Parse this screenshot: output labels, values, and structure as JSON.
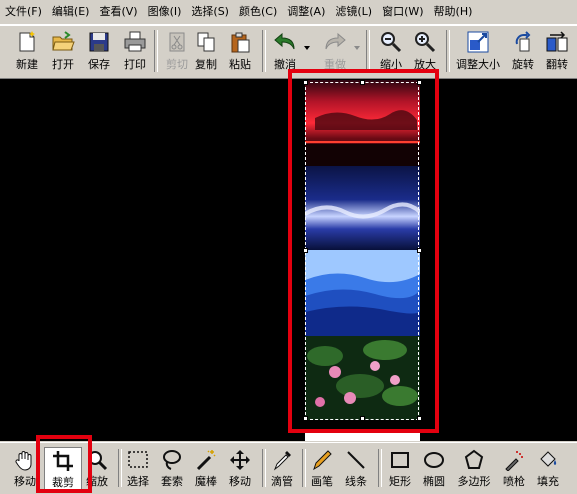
{
  "menu": [
    "文件(F)",
    "编辑(E)",
    "查看(V)",
    "图像(I)",
    "选择(S)",
    "颜色(C)",
    "调整(A)",
    "滤镜(L)",
    "窗口(W)",
    "帮助(H)"
  ],
  "toolbar": {
    "new": "新建",
    "open": "打开",
    "save": "保存",
    "print": "打印",
    "cut": "剪切",
    "copy": "复制",
    "paste": "粘贴",
    "undo": "撤消",
    "redo": "重做",
    "zoom_out": "缩小",
    "zoom_in": "放大",
    "resize": "调整大小",
    "rotate": "旋转",
    "flip": "翻转"
  },
  "tools": {
    "move_partial": "移动",
    "crop": "裁剪",
    "zoom": "缩放",
    "select": "选择",
    "lasso": "套索",
    "magic_wand": "魔棒",
    "move": "移动",
    "eyedropper": "滴管",
    "pen": "画笔",
    "line": "线条",
    "rect": "矩形",
    "ellipse": "椭圆",
    "polygon": "多边形",
    "spray": "喷枪",
    "fill": "填充"
  },
  "colors": {
    "highlight": "#e3000f",
    "canvas": "#000000",
    "chrome": "#d4d0c8"
  }
}
